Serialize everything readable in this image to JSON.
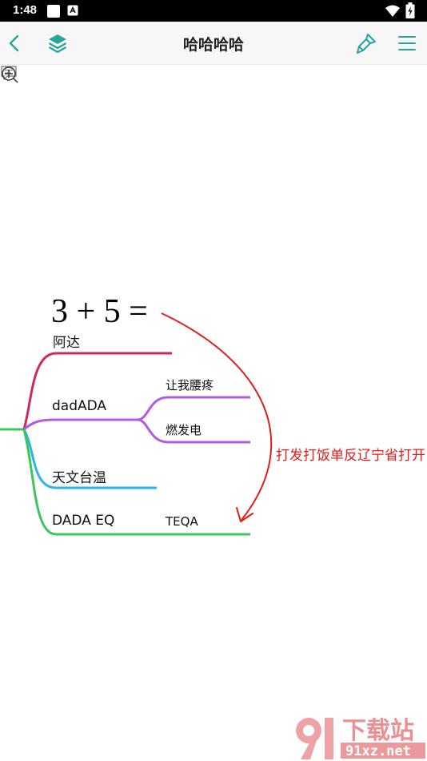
{
  "status": {
    "time": "1:48"
  },
  "header": {
    "title": "哈哈哈哈"
  },
  "icons": {
    "back": "chevron-left-icon",
    "layers": "layers-icon",
    "brush": "brush-icon",
    "menu": "menu-icon"
  },
  "colors": {
    "accent": "#26a69a",
    "branch_red": "#cc2a5a",
    "branch_purple": "#b45ae0",
    "branch_blue": "#2ab6e6",
    "branch_green": "#3cc55a",
    "annotation": "#e51c1c"
  },
  "mindmap": {
    "formula": "3 + 5 =",
    "nodes": {
      "ada": "阿达",
      "dadada": "dadADA",
      "child1": "让我腰疼",
      "child2": "燃发电",
      "tianwen": "天文台温",
      "dadaeq": "DADA EQ",
      "teqa": "TEQA"
    },
    "annotation": "打发打饭单反辽宁省打开"
  },
  "watermark": {
    "text": "下载站",
    "url_text": "91xz.net"
  }
}
